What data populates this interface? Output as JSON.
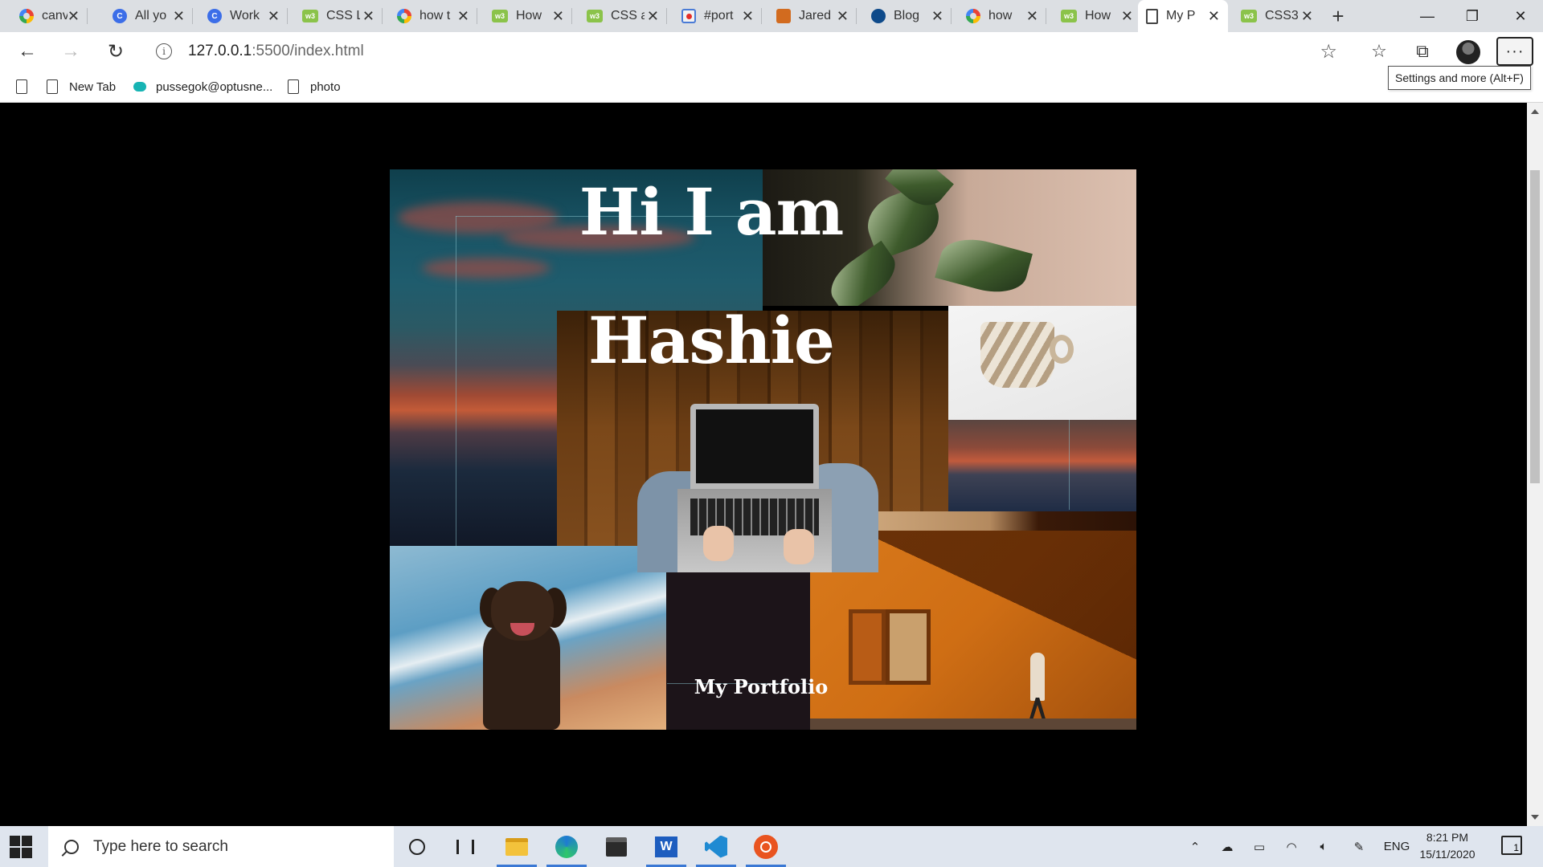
{
  "browser": {
    "tabs": [
      {
        "title": "canva",
        "favicon": "google-icon"
      },
      {
        "title": "All yo",
        "favicon": "c-icon"
      },
      {
        "title": "Work",
        "favicon": "c-icon"
      },
      {
        "title": "CSS L",
        "favicon": "w3-icon"
      },
      {
        "title": "how t",
        "favicon": "google-icon"
      },
      {
        "title": "How",
        "favicon": "w3-icon"
      },
      {
        "title": "CSS a",
        "favicon": "w3-icon"
      },
      {
        "title": "#port",
        "favicon": "youtube-icon"
      },
      {
        "title": "Jared",
        "favicon": "jd-icon"
      },
      {
        "title": "Blog",
        "favicon": "blog-icon"
      },
      {
        "title": "how",
        "favicon": "google-icon"
      },
      {
        "title": "How",
        "favicon": "w3-icon"
      },
      {
        "title": "My P",
        "favicon": "page-icon",
        "active": true
      },
      {
        "title": "CSS3",
        "favicon": "w3-icon"
      }
    ],
    "w3_label": "w3",
    "url_host": "127.0.0.1",
    "url_rest": ":5500/index.html",
    "favorites": [
      {
        "label": "New Tab",
        "icon": "page-icon"
      },
      {
        "label": "pussegok@optusne...",
        "icon": "cloud-icon"
      },
      {
        "label": "photo",
        "icon": "page-icon"
      }
    ],
    "tooltip": "Settings and more (Alt+F)",
    "more_label": "···"
  },
  "page": {
    "heading_line1": "Hi I am",
    "heading_line2": "Hashie",
    "subtitle": "My Portfolio"
  },
  "taskbar": {
    "search_placeholder": "Type here to search",
    "word_letter": "W",
    "language": "ENG",
    "time": "8:21 PM",
    "date": "15/11/2020",
    "notification_count": "1"
  },
  "colors": {
    "page_background": "#000000",
    "tab_strip": "#dcdfe3",
    "taskbar": "#dfe5ee",
    "orange_wall": "#d97a1c"
  }
}
